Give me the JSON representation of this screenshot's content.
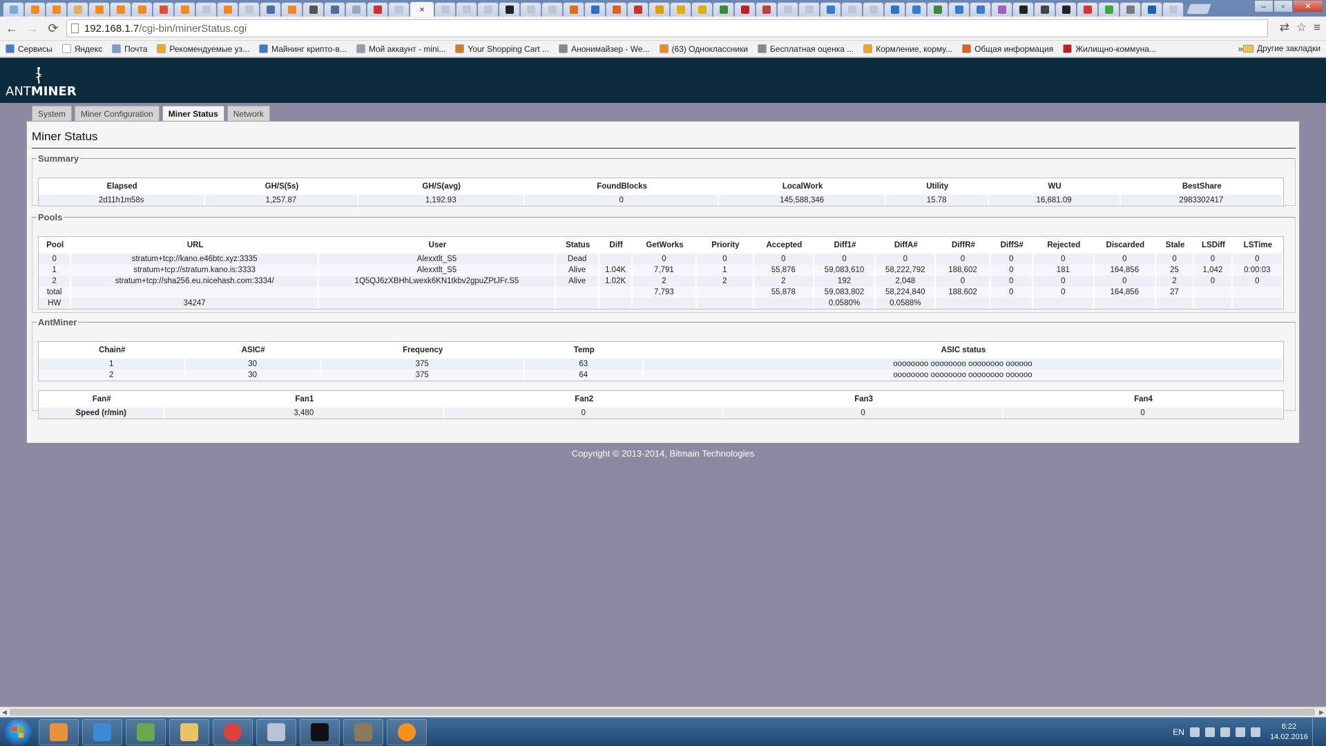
{
  "browser": {
    "url_host": "192.168.1.7",
    "url_path": "/cgi-bin/minerStatus.cgi",
    "tab_favicon_colors": [
      "#7aa7d8",
      "#f28a1f",
      "#f28a1f",
      "#e0b060",
      "#f28a1f",
      "#f28a1f",
      "#f28a1f",
      "#e05030",
      "#f28a1f",
      "#bfc7d5",
      "#f28a1f",
      "#bfc7d5",
      "#4a6fa5",
      "#f28a1f",
      "#555555",
      "#4a6fa5",
      "#9aa7c0",
      "#d03030",
      "#bfc7d5"
    ],
    "tab_favicon_colors_right": [
      "#bfc7d5",
      "#bfc7d5",
      "#bfc7d5",
      "#222222",
      "#bfc7d5",
      "#bfc7d5",
      "#e07020",
      "#3070c0",
      "#e06020",
      "#d03030",
      "#e0a000",
      "#e0b000",
      "#e0b000",
      "#3a8a3a",
      "#c02020",
      "#c04040",
      "#bfc7d5",
      "#bfc7d5",
      "#3a7ad0",
      "#bfc7d5",
      "#bfc7d5",
      "#3070c0",
      "#3a7ad0",
      "#3a8a3a",
      "#3a7ad0",
      "#3a7ad0",
      "#a060c0",
      "#222222",
      "#444444",
      "#222222",
      "#e03030",
      "#3aaa3a",
      "#7a7a7a",
      "#2060b0",
      "#bfc7d5"
    ],
    "bookmarks": [
      {
        "label": "Сервисы",
        "color": "#4a7ad0"
      },
      {
        "label": "Яндекс",
        "color": "#ffffff"
      },
      {
        "label": "Почта",
        "color": "#7a9ad0"
      },
      {
        "label": "Рекомендуемые уз...",
        "color": "#f2a81f"
      },
      {
        "label": "Майнинг крипто-в...",
        "color": "#3a7ad0"
      },
      {
        "label": "Мой аккаунт - mini...",
        "color": "#9a9ab0"
      },
      {
        "label": "Your Shopping Cart ...",
        "color": "#d08020"
      },
      {
        "label": "Анонимайзер - We...",
        "color": "#888888"
      },
      {
        "label": "(63) Одноклассники",
        "color": "#f28a1f"
      },
      {
        "label": "Бесплатная оценка ...",
        "color": "#888888"
      },
      {
        "label": "Кормление, корму...",
        "color": "#f2a81f"
      },
      {
        "label": "Общая информация",
        "color": "#e06020"
      },
      {
        "label": "Жилищно-коммуна...",
        "color": "#c02020"
      }
    ],
    "bookmarks_more": "»",
    "bookmarks_other": "Другие закладки"
  },
  "app": {
    "logo_ant": "ANT",
    "logo_miner": "MINER",
    "tabs": [
      {
        "label": "System",
        "active": false
      },
      {
        "label": "Miner Configuration",
        "active": false
      },
      {
        "label": "Miner Status",
        "active": true
      },
      {
        "label": "Network",
        "active": false
      }
    ],
    "page_title": "Miner Status",
    "footer": "Copyright © 2013-2014, Bitmain Technologies"
  },
  "summary": {
    "legend": "Summary",
    "headers": [
      "Elapsed",
      "GH/S(5s)",
      "GH/S(avg)",
      "FoundBlocks",
      "LocalWork",
      "Utility",
      "WU",
      "BestShare"
    ],
    "row": [
      "2d11h1m58s",
      "1,257.87",
      "1,192.93",
      "0",
      "145,588,346",
      "15.78",
      "16,681.09",
      "2983302417"
    ]
  },
  "pools": {
    "legend": "Pools",
    "headers": [
      "Pool",
      "URL",
      "User",
      "Status",
      "Diff",
      "GetWorks",
      "Priority",
      "Accepted",
      "Diff1#",
      "DiffA#",
      "DiffR#",
      "DiffS#",
      "Rejected",
      "Discarded",
      "Stale",
      "LSDiff",
      "LSTime"
    ],
    "rows": [
      [
        "0",
        "stratum+tcp://kano.e46btc.xyz:3335",
        "Alexxtlt_S5",
        "Dead",
        "",
        "0",
        "0",
        "0",
        "0",
        "0",
        "0",
        "0",
        "0",
        "0",
        "0",
        "0",
        "0"
      ],
      [
        "1",
        "stratum+tcp://stratum.kano.is:3333",
        "Alexxtlt_S5",
        "Alive",
        "1.04K",
        "7,791",
        "1",
        "55,876",
        "59,083,610",
        "58,222,792",
        "188,602",
        "0",
        "181",
        "164,856",
        "25",
        "1,042",
        "0:00:03"
      ],
      [
        "2",
        "stratum+tcp://sha256.eu.nicehash.com:3334/",
        "1Q5QJ6zXBHhLwexk6KN1tkbv2gpuZPtJFr.S5",
        "Alive",
        "1.02K",
        "2",
        "2",
        "2",
        "192",
        "2,048",
        "0",
        "0",
        "0",
        "0",
        "2",
        "0",
        "0"
      ],
      [
        "total",
        "",
        "",
        "",
        "",
        "7,793",
        "",
        "55,878",
        "59,083,802",
        "58,224,840",
        "188,602",
        "0",
        "0",
        "164,856",
        "27",
        "",
        ""
      ],
      [
        "HW",
        "34247",
        "",
        "",
        "",
        "",
        "",
        "",
        "0.0580%",
        "0.0588%",
        "",
        "",
        "",
        "",
        "",
        "",
        ""
      ]
    ]
  },
  "antminer": {
    "legend": "AntMiner",
    "chain_headers": [
      "Chain#",
      "ASIC#",
      "Frequency",
      "Temp",
      "ASIC status"
    ],
    "chain_rows": [
      [
        "1",
        "30",
        "375",
        "63",
        "oooooooo oooooooo oooooooo oooooo"
      ],
      [
        "2",
        "30",
        "375",
        "64",
        "oooooooo oooooooo oooooooo oooooo"
      ]
    ],
    "fan_headers": [
      "Fan#",
      "Fan1",
      "Fan2",
      "Fan3",
      "Fan4"
    ],
    "fan_row": [
      "Speed (r/min)",
      "3,480",
      "0",
      "0",
      "0"
    ]
  },
  "taskbar": {
    "apps": [
      {
        "name": "media-player",
        "color": "#e8923a"
      },
      {
        "name": "internet-explorer",
        "color": "#3a8ad8"
      },
      {
        "name": "spreadsheet",
        "color": "#6aa84f"
      },
      {
        "name": "file-explorer",
        "color": "#e8c462"
      },
      {
        "name": "chrome",
        "color": "#db4437"
      },
      {
        "name": "calculator",
        "color": "#b8c4d4"
      },
      {
        "name": "command-prompt",
        "color": "#111111"
      },
      {
        "name": "miner-app",
        "color": "#8a7a5a"
      },
      {
        "name": "bitcoin-app",
        "color": "#f7931a"
      }
    ],
    "lang": "EN",
    "time": "8:22",
    "date": "14.02.2016"
  }
}
